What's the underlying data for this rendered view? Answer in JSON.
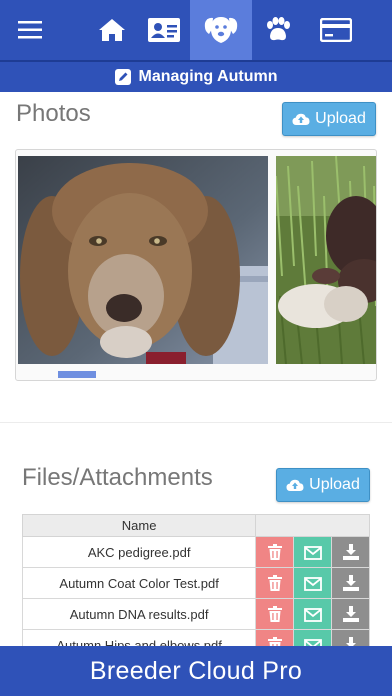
{
  "nav": {
    "items": [
      {
        "icon": "menu-icon"
      },
      {
        "icon": "home-icon"
      },
      {
        "icon": "id-card-icon"
      },
      {
        "icon": "dog-face-icon",
        "active": true
      },
      {
        "icon": "paw-icon"
      },
      {
        "icon": "credit-card-icon"
      }
    ]
  },
  "subheader": {
    "icon": "edit-icon",
    "title": "Managing Autumn"
  },
  "photos": {
    "title": "Photos",
    "upload_label": "Upload",
    "images": [
      {
        "desc": "brown poodle portrait"
      },
      {
        "desc": "puppy lying in grass"
      }
    ]
  },
  "files": {
    "title": "Files/Attachments",
    "upload_label": "Upload",
    "column_name": "Name",
    "rows": [
      {
        "name": "AKC pedigree.pdf"
      },
      {
        "name": "Autumn Coat Color Test.pdf"
      },
      {
        "name": "Autumn DNA results.pdf"
      },
      {
        "name": "Autumn Hips and elbows.pdf"
      }
    ],
    "action_icons": [
      "trash-icon",
      "envelope-icon",
      "download-icon"
    ]
  },
  "footer": {
    "text": "Breeder Cloud Pro"
  },
  "colors": {
    "primary": "#2f52b8",
    "active": "#5b7ddc",
    "upload": "#5aaee3",
    "delete": "#f08585",
    "email": "#58c9a9",
    "download": "#8e8e8e"
  }
}
